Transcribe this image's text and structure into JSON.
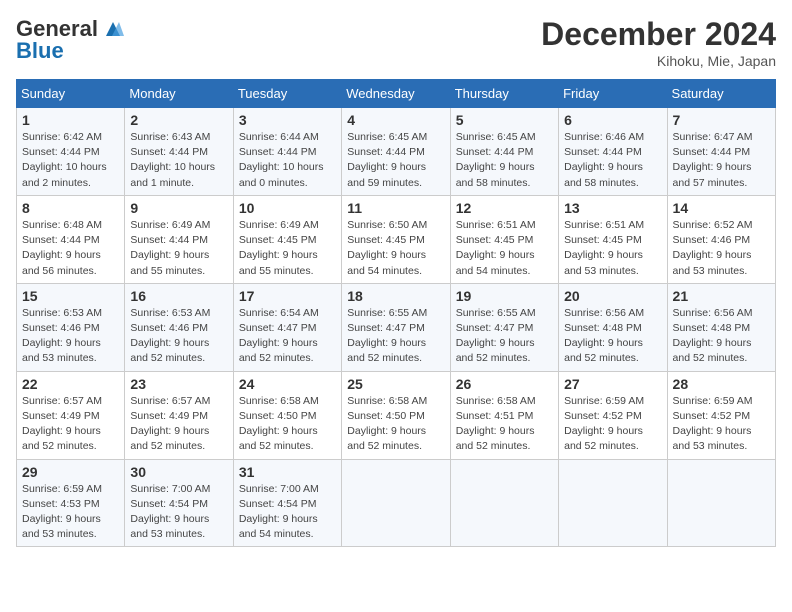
{
  "header": {
    "logo_general": "General",
    "logo_blue": "Blue",
    "month_title": "December 2024",
    "location": "Kihoku, Mie, Japan"
  },
  "weekdays": [
    "Sunday",
    "Monday",
    "Tuesday",
    "Wednesday",
    "Thursday",
    "Friday",
    "Saturday"
  ],
  "weeks": [
    [
      {
        "day": "1",
        "sunrise": "Sunrise: 6:42 AM",
        "sunset": "Sunset: 4:44 PM",
        "daylight": "Daylight: 10 hours and 2 minutes."
      },
      {
        "day": "2",
        "sunrise": "Sunrise: 6:43 AM",
        "sunset": "Sunset: 4:44 PM",
        "daylight": "Daylight: 10 hours and 1 minute."
      },
      {
        "day": "3",
        "sunrise": "Sunrise: 6:44 AM",
        "sunset": "Sunset: 4:44 PM",
        "daylight": "Daylight: 10 hours and 0 minutes."
      },
      {
        "day": "4",
        "sunrise": "Sunrise: 6:45 AM",
        "sunset": "Sunset: 4:44 PM",
        "daylight": "Daylight: 9 hours and 59 minutes."
      },
      {
        "day": "5",
        "sunrise": "Sunrise: 6:45 AM",
        "sunset": "Sunset: 4:44 PM",
        "daylight": "Daylight: 9 hours and 58 minutes."
      },
      {
        "day": "6",
        "sunrise": "Sunrise: 6:46 AM",
        "sunset": "Sunset: 4:44 PM",
        "daylight": "Daylight: 9 hours and 58 minutes."
      },
      {
        "day": "7",
        "sunrise": "Sunrise: 6:47 AM",
        "sunset": "Sunset: 4:44 PM",
        "daylight": "Daylight: 9 hours and 57 minutes."
      }
    ],
    [
      {
        "day": "8",
        "sunrise": "Sunrise: 6:48 AM",
        "sunset": "Sunset: 4:44 PM",
        "daylight": "Daylight: 9 hours and 56 minutes."
      },
      {
        "day": "9",
        "sunrise": "Sunrise: 6:49 AM",
        "sunset": "Sunset: 4:44 PM",
        "daylight": "Daylight: 9 hours and 55 minutes."
      },
      {
        "day": "10",
        "sunrise": "Sunrise: 6:49 AM",
        "sunset": "Sunset: 4:45 PM",
        "daylight": "Daylight: 9 hours and 55 minutes."
      },
      {
        "day": "11",
        "sunrise": "Sunrise: 6:50 AM",
        "sunset": "Sunset: 4:45 PM",
        "daylight": "Daylight: 9 hours and 54 minutes."
      },
      {
        "day": "12",
        "sunrise": "Sunrise: 6:51 AM",
        "sunset": "Sunset: 4:45 PM",
        "daylight": "Daylight: 9 hours and 54 minutes."
      },
      {
        "day": "13",
        "sunrise": "Sunrise: 6:51 AM",
        "sunset": "Sunset: 4:45 PM",
        "daylight": "Daylight: 9 hours and 53 minutes."
      },
      {
        "day": "14",
        "sunrise": "Sunrise: 6:52 AM",
        "sunset": "Sunset: 4:46 PM",
        "daylight": "Daylight: 9 hours and 53 minutes."
      }
    ],
    [
      {
        "day": "15",
        "sunrise": "Sunrise: 6:53 AM",
        "sunset": "Sunset: 4:46 PM",
        "daylight": "Daylight: 9 hours and 53 minutes."
      },
      {
        "day": "16",
        "sunrise": "Sunrise: 6:53 AM",
        "sunset": "Sunset: 4:46 PM",
        "daylight": "Daylight: 9 hours and 52 minutes."
      },
      {
        "day": "17",
        "sunrise": "Sunrise: 6:54 AM",
        "sunset": "Sunset: 4:47 PM",
        "daylight": "Daylight: 9 hours and 52 minutes."
      },
      {
        "day": "18",
        "sunrise": "Sunrise: 6:55 AM",
        "sunset": "Sunset: 4:47 PM",
        "daylight": "Daylight: 9 hours and 52 minutes."
      },
      {
        "day": "19",
        "sunrise": "Sunrise: 6:55 AM",
        "sunset": "Sunset: 4:47 PM",
        "daylight": "Daylight: 9 hours and 52 minutes."
      },
      {
        "day": "20",
        "sunrise": "Sunrise: 6:56 AM",
        "sunset": "Sunset: 4:48 PM",
        "daylight": "Daylight: 9 hours and 52 minutes."
      },
      {
        "day": "21",
        "sunrise": "Sunrise: 6:56 AM",
        "sunset": "Sunset: 4:48 PM",
        "daylight": "Daylight: 9 hours and 52 minutes."
      }
    ],
    [
      {
        "day": "22",
        "sunrise": "Sunrise: 6:57 AM",
        "sunset": "Sunset: 4:49 PM",
        "daylight": "Daylight: 9 hours and 52 minutes."
      },
      {
        "day": "23",
        "sunrise": "Sunrise: 6:57 AM",
        "sunset": "Sunset: 4:49 PM",
        "daylight": "Daylight: 9 hours and 52 minutes."
      },
      {
        "day": "24",
        "sunrise": "Sunrise: 6:58 AM",
        "sunset": "Sunset: 4:50 PM",
        "daylight": "Daylight: 9 hours and 52 minutes."
      },
      {
        "day": "25",
        "sunrise": "Sunrise: 6:58 AM",
        "sunset": "Sunset: 4:50 PM",
        "daylight": "Daylight: 9 hours and 52 minutes."
      },
      {
        "day": "26",
        "sunrise": "Sunrise: 6:58 AM",
        "sunset": "Sunset: 4:51 PM",
        "daylight": "Daylight: 9 hours and 52 minutes."
      },
      {
        "day": "27",
        "sunrise": "Sunrise: 6:59 AM",
        "sunset": "Sunset: 4:52 PM",
        "daylight": "Daylight: 9 hours and 52 minutes."
      },
      {
        "day": "28",
        "sunrise": "Sunrise: 6:59 AM",
        "sunset": "Sunset: 4:52 PM",
        "daylight": "Daylight: 9 hours and 53 minutes."
      }
    ],
    [
      {
        "day": "29",
        "sunrise": "Sunrise: 6:59 AM",
        "sunset": "Sunset: 4:53 PM",
        "daylight": "Daylight: 9 hours and 53 minutes."
      },
      {
        "day": "30",
        "sunrise": "Sunrise: 7:00 AM",
        "sunset": "Sunset: 4:54 PM",
        "daylight": "Daylight: 9 hours and 53 minutes."
      },
      {
        "day": "31",
        "sunrise": "Sunrise: 7:00 AM",
        "sunset": "Sunset: 4:54 PM",
        "daylight": "Daylight: 9 hours and 54 minutes."
      },
      null,
      null,
      null,
      null
    ]
  ]
}
